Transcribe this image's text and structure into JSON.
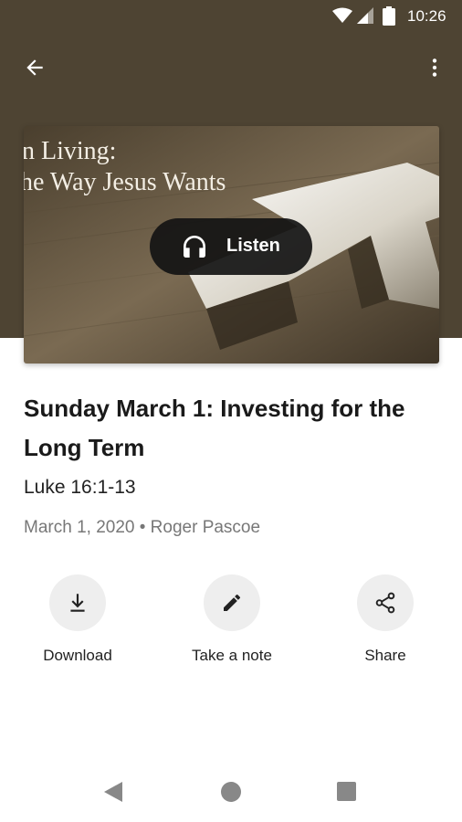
{
  "status_bar": {
    "time": "10:26"
  },
  "header": {
    "back_icon": "arrow-back-icon",
    "menu_icon": "more-vert-icon"
  },
  "artwork": {
    "text_line1": "n Living:",
    "text_line2": "he Way Jesus Wants",
    "listen_label": "Listen",
    "listen_icon": "headphones-icon"
  },
  "sermon": {
    "title": "Sunday March 1: Investing for the Long Term",
    "scripture": "Luke 16:1-13",
    "meta": "March 1, 2020 • Roger Pascoe"
  },
  "actions": [
    {
      "label": "Download",
      "icon": "download-icon"
    },
    {
      "label": "Take a note",
      "icon": "pencil-icon"
    },
    {
      "label": "Share",
      "icon": "share-icon"
    }
  ],
  "colors": {
    "header_bg": "#4e4433",
    "button_bg": "#eeeeee",
    "pill_bg": "#141414"
  }
}
